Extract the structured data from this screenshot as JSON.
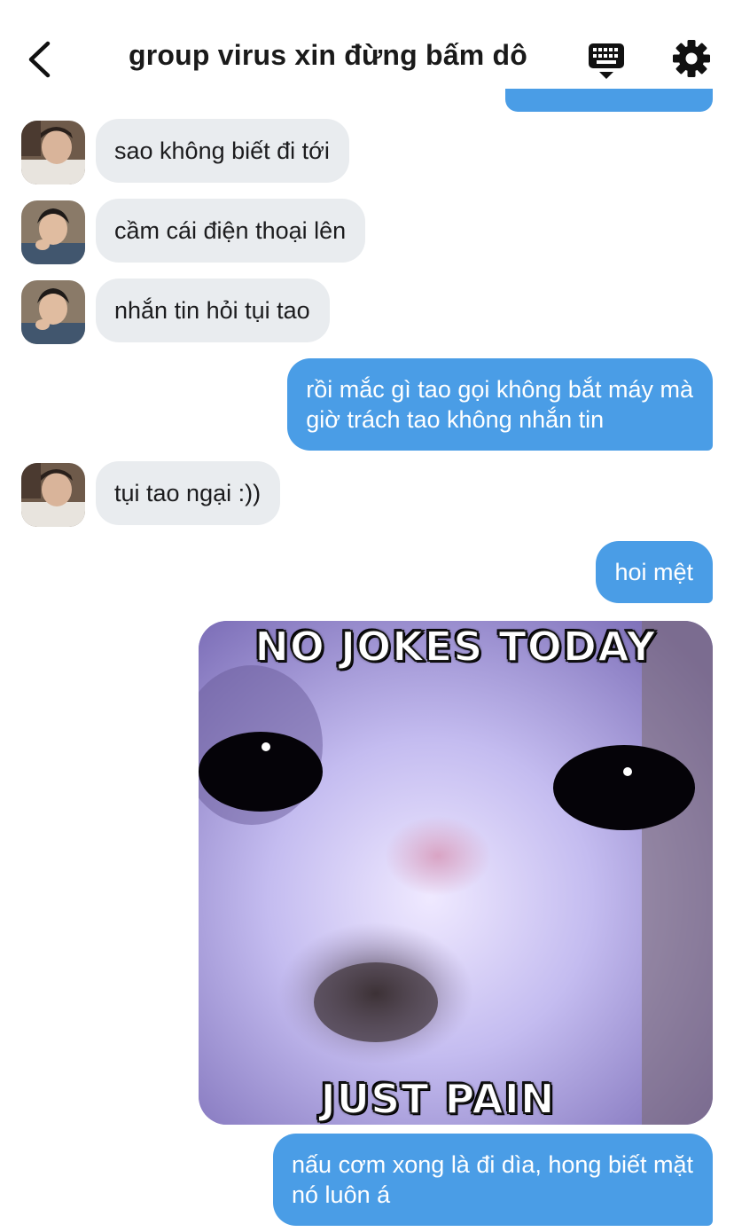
{
  "header": {
    "title": "group virus xin đừng bấm dô",
    "back_icon": "chevron-left-icon",
    "keyboard_icon": "keyboard-icon",
    "settings_icon": "gear-icon"
  },
  "colors": {
    "outgoing": "#4a9de6",
    "incoming": "#e9ecef",
    "text_dark": "#1c1c1e"
  },
  "messages": [
    {
      "direction": "in",
      "text": "sao không biết đi tới"
    },
    {
      "direction": "in",
      "text": "cầm cái điện thoại lên"
    },
    {
      "direction": "in",
      "text": "nhắn tin hỏi tụi tao"
    },
    {
      "direction": "out",
      "line1": "rồi mắc gì tao gọi không bắt máy mà",
      "line2": "giờ trách tao không nhắn tin"
    },
    {
      "direction": "in",
      "text": "tụi tao ngại :))"
    },
    {
      "direction": "out",
      "text": "hoi mệt"
    },
    {
      "direction": "out",
      "type": "sticker",
      "top_text": "NO JOKES TODAY",
      "bottom_text": "JUST PAIN"
    },
    {
      "direction": "out",
      "line1": "nấu cơm xong là đi dìa, hong biết mặt",
      "line2": "nó luôn á"
    }
  ]
}
